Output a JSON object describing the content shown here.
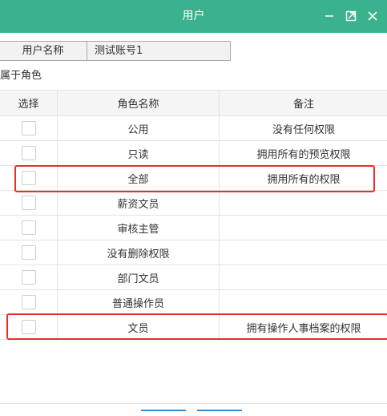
{
  "window": {
    "title": "用户"
  },
  "user": {
    "name_label": "用户名称",
    "name_value": "测试账号1"
  },
  "roles_section": {
    "label": "属于角色"
  },
  "table": {
    "headers": [
      "选择",
      "角色名称",
      "备注"
    ],
    "rows": [
      {
        "name": "公用",
        "note": "没有任何权限"
      },
      {
        "name": "只读",
        "note": "拥用所有的预览权限"
      },
      {
        "name": "全部",
        "note": "拥用所有的权限"
      },
      {
        "name": "薪资文员",
        "note": ""
      },
      {
        "name": "审核主管",
        "note": ""
      },
      {
        "name": "没有删除权限",
        "note": ""
      },
      {
        "name": "部门文员",
        "note": ""
      },
      {
        "name": "普通操作员",
        "note": ""
      },
      {
        "name": "文员",
        "note": "拥有操作人事档案的权限"
      }
    ]
  },
  "colors": {
    "titlebar": "#3ab28e",
    "highlight": "#e8302a"
  },
  "icons": [
    "minimize-icon",
    "maximize-icon",
    "close-icon"
  ]
}
